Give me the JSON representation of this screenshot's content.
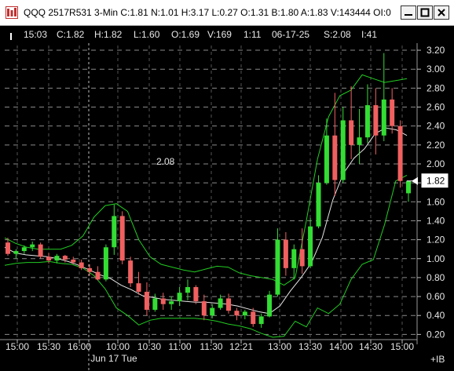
{
  "window": {
    "title": "QQQ 2517R531 3-Min C:1.81 N:1.01 H:3.17 L:0.27 O:1.31 B:1.80 A:1.83 V:143444 OI:0",
    "app_icon": "trading-chart-app-icon",
    "controls": [
      "minimize",
      "maximize",
      "close"
    ]
  },
  "info_bar": {
    "time": "15:03",
    "close": "C:1.82",
    "high": "H:1.82",
    "low": "L:1.60",
    "open": "O:1.69",
    "volume": "V:169",
    "ticks": "1:11",
    "date": "06-17-25",
    "strike": "S:2.08",
    "interval": "I:41"
  },
  "chart_data": {
    "type": "candlestick",
    "title": "",
    "y_axis": {
      "ticks": [
        "3.20",
        "3.00",
        "2.80",
        "2.60",
        "2.40",
        "2.20",
        "2.00",
        "1.80",
        "1.60",
        "1.40",
        "1.20",
        "1.00",
        "0.80",
        "0.60",
        "0.40",
        "0.20"
      ],
      "range": [
        0.17,
        3.25
      ],
      "current_price_marker": "1.82",
      "scale_button": "+IB"
    },
    "x_axis": {
      "ticks": [
        "15:00",
        "15:30",
        "16:00",
        "10:00",
        "10:30",
        "11:00",
        "11:30",
        "12:21",
        "13:00",
        "13:30",
        "14:00",
        "14:30",
        "15:00"
      ],
      "day_separators": [
        "16:00"
      ],
      "date_label": "Jun 17 Tue"
    },
    "annotation": "2.08",
    "series": [
      {
        "kind": "bollinger_upper",
        "color": "#22cc22",
        "values": [
          1.22,
          1.16,
          1.12,
          1.1,
          1.1,
          1.1,
          1.14,
          1.24,
          1.44,
          1.56,
          1.58,
          1.5,
          1.2,
          1.02,
          0.94,
          0.91,
          0.88,
          0.86,
          0.89,
          0.92,
          0.91,
          0.85,
          0.82,
          0.8,
          0.78,
          0.72,
          0.8,
          1.4,
          2.05,
          2.5,
          2.72,
          2.78,
          2.94,
          2.9,
          2.86,
          2.88,
          2.9
        ]
      },
      {
        "kind": "moving_average",
        "color": "#e6e6e6",
        "values": [
          1.12,
          1.06,
          1.04,
          1.03,
          1.02,
          1.0,
          0.97,
          0.93,
          0.88,
          0.83,
          0.79,
          0.72,
          0.67,
          0.61,
          0.59,
          0.57,
          0.56,
          0.55,
          0.54,
          0.54,
          0.53,
          0.52,
          0.5,
          0.47,
          0.44,
          0.42,
          0.5,
          0.66,
          0.8,
          0.96,
          1.22,
          1.62,
          1.9,
          2.06,
          2.16,
          2.32,
          2.38,
          2.36,
          2.3
        ]
      },
      {
        "kind": "bollinger_lower",
        "color": "#22cc22",
        "values": [
          0.93,
          0.95,
          0.96,
          0.96,
          0.97,
          0.95,
          0.94,
          0.9,
          0.82,
          0.68,
          0.48,
          0.4,
          0.3,
          0.35,
          0.37,
          0.37,
          0.37,
          0.37,
          0.36,
          0.34,
          0.31,
          0.29,
          0.26,
          0.21,
          0.17,
          0.18,
          0.34,
          0.28,
          0.48,
          0.42,
          0.52,
          0.78,
          0.94,
          0.99,
          1.36,
          1.82,
          1.88
        ]
      },
      {
        "kind": "price",
        "candles": [
          {
            "o": 1.17,
            "h": 1.22,
            "l": 1.03,
            "c": 1.05
          },
          {
            "o": 1.05,
            "h": 1.1,
            "l": 1.0,
            "c": 1.08
          },
          {
            "o": 1.08,
            "h": 1.14,
            "l": 1.05,
            "c": 1.12
          },
          {
            "o": 1.12,
            "h": 1.18,
            "l": 1.08,
            "c": 1.15
          },
          {
            "o": 1.15,
            "h": 1.17,
            "l": 1.0,
            "c": 1.02
          },
          {
            "o": 1.02,
            "h": 1.06,
            "l": 0.95,
            "c": 0.98
          },
          {
            "o": 0.98,
            "h": 1.05,
            "l": 0.95,
            "c": 1.03
          },
          {
            "o": 1.03,
            "h": 1.04,
            "l": 0.96,
            "c": 0.99
          },
          {
            "o": 0.99,
            "h": 1.02,
            "l": 0.94,
            "c": 0.96
          },
          {
            "o": 0.96,
            "h": 0.99,
            "l": 0.88,
            "c": 0.9
          },
          {
            "o": 0.9,
            "h": 0.94,
            "l": 0.82,
            "c": 0.86
          },
          {
            "o": 0.86,
            "h": 0.92,
            "l": 0.77,
            "c": 0.78
          },
          {
            "o": 0.78,
            "h": 1.15,
            "l": 0.76,
            "c": 1.12
          },
          {
            "o": 1.12,
            "h": 1.57,
            "l": 1.04,
            "c": 1.45
          },
          {
            "o": 1.45,
            "h": 1.5,
            "l": 0.94,
            "c": 0.98
          },
          {
            "o": 0.98,
            "h": 1.02,
            "l": 0.7,
            "c": 0.74
          },
          {
            "o": 0.74,
            "h": 0.86,
            "l": 0.62,
            "c": 0.65
          },
          {
            "o": 0.65,
            "h": 0.75,
            "l": 0.4,
            "c": 0.46
          },
          {
            "o": 0.46,
            "h": 0.63,
            "l": 0.44,
            "c": 0.58
          },
          {
            "o": 0.58,
            "h": 0.64,
            "l": 0.46,
            "c": 0.52
          },
          {
            "o": 0.52,
            "h": 0.6,
            "l": 0.46,
            "c": 0.55
          },
          {
            "o": 0.55,
            "h": 0.7,
            "l": 0.5,
            "c": 0.64
          },
          {
            "o": 0.64,
            "h": 0.78,
            "l": 0.56,
            "c": 0.7
          },
          {
            "o": 0.7,
            "h": 0.72,
            "l": 0.52,
            "c": 0.55
          },
          {
            "o": 0.55,
            "h": 0.62,
            "l": 0.35,
            "c": 0.4
          },
          {
            "o": 0.4,
            "h": 0.52,
            "l": 0.37,
            "c": 0.48
          },
          {
            "o": 0.48,
            "h": 0.62,
            "l": 0.46,
            "c": 0.58
          },
          {
            "o": 0.58,
            "h": 0.63,
            "l": 0.42,
            "c": 0.45
          },
          {
            "o": 0.45,
            "h": 0.48,
            "l": 0.35,
            "c": 0.4
          },
          {
            "o": 0.4,
            "h": 0.46,
            "l": 0.36,
            "c": 0.44
          },
          {
            "o": 0.44,
            "h": 0.48,
            "l": 0.28,
            "c": 0.31
          },
          {
            "o": 0.31,
            "h": 0.42,
            "l": 0.27,
            "c": 0.39
          },
          {
            "o": 0.39,
            "h": 0.66,
            "l": 0.38,
            "c": 0.62
          },
          {
            "o": 0.62,
            "h": 1.32,
            "l": 0.6,
            "c": 1.2
          },
          {
            "o": 1.2,
            "h": 1.28,
            "l": 0.82,
            "c": 0.9
          },
          {
            "o": 0.9,
            "h": 1.15,
            "l": 0.78,
            "c": 1.1
          },
          {
            "o": 1.1,
            "h": 1.32,
            "l": 0.84,
            "c": 0.92
          },
          {
            "o": 0.92,
            "h": 1.43,
            "l": 0.9,
            "c": 1.34
          },
          {
            "o": 1.34,
            "h": 1.88,
            "l": 1.32,
            "c": 1.8
          },
          {
            "o": 1.8,
            "h": 2.48,
            "l": 1.78,
            "c": 2.3
          },
          {
            "o": 2.3,
            "h": 2.75,
            "l": 1.66,
            "c": 1.83
          },
          {
            "o": 1.83,
            "h": 2.6,
            "l": 1.8,
            "c": 2.46
          },
          {
            "o": 2.46,
            "h": 2.82,
            "l": 2.05,
            "c": 2.2
          },
          {
            "o": 2.2,
            "h": 2.58,
            "l": 2.0,
            "c": 2.28
          },
          {
            "o": 2.28,
            "h": 2.84,
            "l": 2.22,
            "c": 2.62
          },
          {
            "o": 2.62,
            "h": 2.8,
            "l": 2.1,
            "c": 2.3
          },
          {
            "o": 2.3,
            "h": 3.17,
            "l": 2.24,
            "c": 2.68
          },
          {
            "o": 2.68,
            "h": 2.8,
            "l": 2.32,
            "c": 2.4
          },
          {
            "o": 2.4,
            "h": 2.46,
            "l": 1.75,
            "c": 1.82
          },
          {
            "o": 1.69,
            "h": 1.82,
            "l": 1.6,
            "c": 1.82
          }
        ]
      }
    ]
  }
}
